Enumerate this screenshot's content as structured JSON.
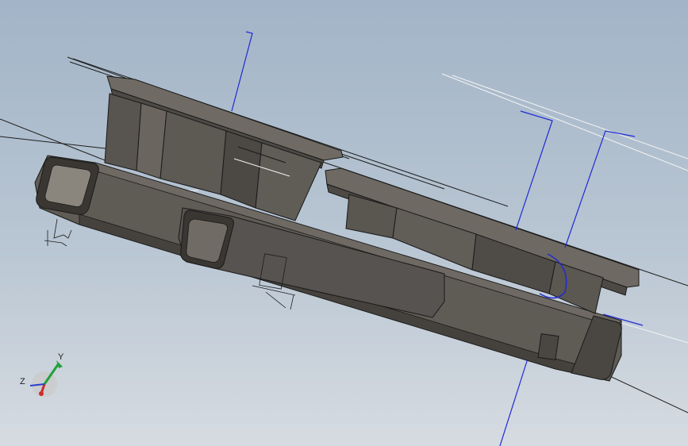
{
  "viewport": {
    "background_top": "#a2b4c7",
    "background_bottom": "#d6dbe1"
  },
  "model": {
    "body_color": "#5c5852",
    "face_light": "#6e6a63",
    "face_dark": "#45423d",
    "edge_color": "#1a1a1a",
    "sketch_color": "#1f2ad6",
    "highlight_color": "#f2f2f2"
  },
  "triad": {
    "y_label": "Y",
    "z_label": "Z",
    "y_axis_color": "#21a13a",
    "x_axis_color": "#d12a2a",
    "z_axis_color": "#2a3fd1",
    "icon": "view-orientation-triad"
  }
}
